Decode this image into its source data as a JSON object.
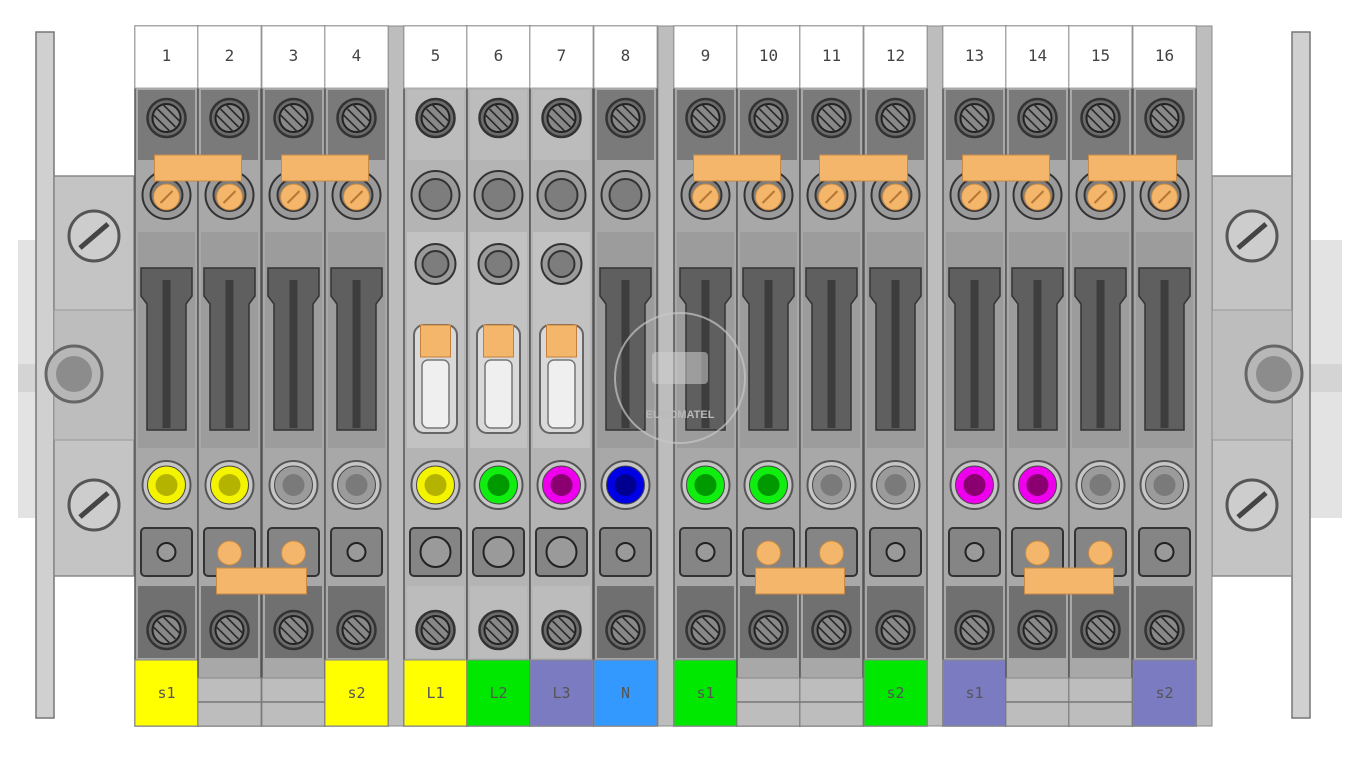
{
  "watermark": "EUROMATEL",
  "colors": {
    "terminal_body": "#8f8f8f",
    "terminal_dark": "#707070",
    "rail": "#c9c9c9",
    "bridge": "#f4b66a",
    "yellow": "#ffff00",
    "green": "#00e800",
    "purple": "#7b7bc2",
    "blue": "#3399ff"
  },
  "terminals": [
    {
      "number": "1",
      "label": "s1",
      "label_color": "yellow",
      "led": "yellow"
    },
    {
      "number": "2",
      "label": "",
      "label_color": "",
      "led": "yellow"
    },
    {
      "number": "3",
      "label": "",
      "label_color": "",
      "led": "gray"
    },
    {
      "number": "4",
      "label": "s2",
      "label_color": "yellow",
      "led": "gray"
    },
    {
      "number": "5",
      "label": "L1",
      "label_color": "yellow",
      "led": "yellow"
    },
    {
      "number": "6",
      "label": "L2",
      "label_color": "green",
      "led": "green"
    },
    {
      "number": "7",
      "label": "L3",
      "label_color": "purple",
      "led": "magenta"
    },
    {
      "number": "8",
      "label": "N",
      "label_color": "blue",
      "led": "blue"
    },
    {
      "number": "9",
      "label": "s1",
      "label_color": "green",
      "led": "green"
    },
    {
      "number": "10",
      "label": "",
      "label_color": "",
      "led": "green"
    },
    {
      "number": "11",
      "label": "",
      "label_color": "",
      "led": "gray"
    },
    {
      "number": "12",
      "label": "s2",
      "label_color": "green",
      "led": "gray"
    },
    {
      "number": "13",
      "label": "s1",
      "label_color": "purple",
      "led": "magenta"
    },
    {
      "number": "14",
      "label": "",
      "label_color": "",
      "led": "magenta"
    },
    {
      "number": "15",
      "label": "",
      "label_color": "",
      "led": "gray"
    },
    {
      "number": "16",
      "label": "s2",
      "label_color": "purple",
      "led": "gray"
    }
  ],
  "top_bridges": [
    [
      "1",
      "2"
    ],
    [
      "3",
      "4"
    ],
    [
      "9",
      "10"
    ],
    [
      "11",
      "12"
    ],
    [
      "13",
      "14"
    ],
    [
      "15",
      "16"
    ]
  ],
  "bottom_bridges": [
    [
      "2",
      "3"
    ],
    [
      "10",
      "11"
    ],
    [
      "14",
      "15"
    ]
  ],
  "fuse_terminals": [
    "5",
    "6",
    "7"
  ]
}
